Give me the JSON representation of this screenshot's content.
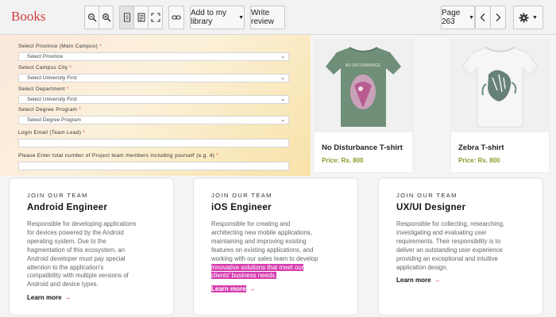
{
  "toolbar": {
    "brand": "Books",
    "add_to_library": "Add to my library",
    "write_review": "Write review",
    "page_label": "Page 263"
  },
  "form": {
    "province_label": "Select Province (Main Campus)",
    "province_value": "Select Province",
    "city_label": "Select Campus City",
    "city_value": "Select University First",
    "department_label": "Select Department",
    "department_value": "Select University First",
    "program_label": "Select Degree Program",
    "program_value": "Select Degree Program",
    "email_label": "Login Email (Team Lead)",
    "members_label": "Please Enter total number of Project team members including yourself (e.g. 4)",
    "required_mark": "*"
  },
  "products": [
    {
      "name": "No Disturbance T-shirt",
      "price": "Price: Rs. 800",
      "shirt_color": "#6f8f78",
      "print_text": "NO DISTURBANCE"
    },
    {
      "name": "Zebra T-shirt",
      "price": "Price: Rs. 800",
      "shirt_color": "#f6f6f6"
    }
  ],
  "jobs": [
    {
      "kicker": "JOIN OUR TEAM",
      "title": "Android Engineer",
      "lines": [
        "Responsible for developing applications",
        "for devices powered by the Android",
        "operating system. Due to the",
        "fragmentation of this ecosystem, an",
        "Android developer must pay special",
        "attention to the application's",
        "compatibility with multiple versions of",
        "Android and device types."
      ],
      "link": "Learn more",
      "arrow": "→"
    },
    {
      "kicker": "JOIN OUR TEAM",
      "title": "iOS Engineer",
      "lines": [
        "Responsible for creating and",
        "architecting new mobile applications,",
        "maintaining and improving existing",
        "features on existing applications, and",
        "working with our sales team to develop"
      ],
      "highlight_lines": [
        "innovative solutions that meet our",
        "clients' business needs."
      ],
      "link": "Learn more",
      "arrow": "→"
    },
    {
      "kicker": "JOIN OUR TEAM",
      "title": "UX/UI Designer",
      "lines": [
        "Responsible for collecting, researching,",
        "investigating and evaluating user",
        "requirements. Their responsibility is to",
        "deliver an outstanding user experience",
        "providing an exceptional and intuitive",
        "application design."
      ],
      "link": "Learn more",
      "arrow": "→"
    }
  ],
  "colors": {
    "accent": "#d4237d",
    "highlight": "#d63eb0",
    "price": "#8a9a2a",
    "brand": "#d03a3a"
  }
}
